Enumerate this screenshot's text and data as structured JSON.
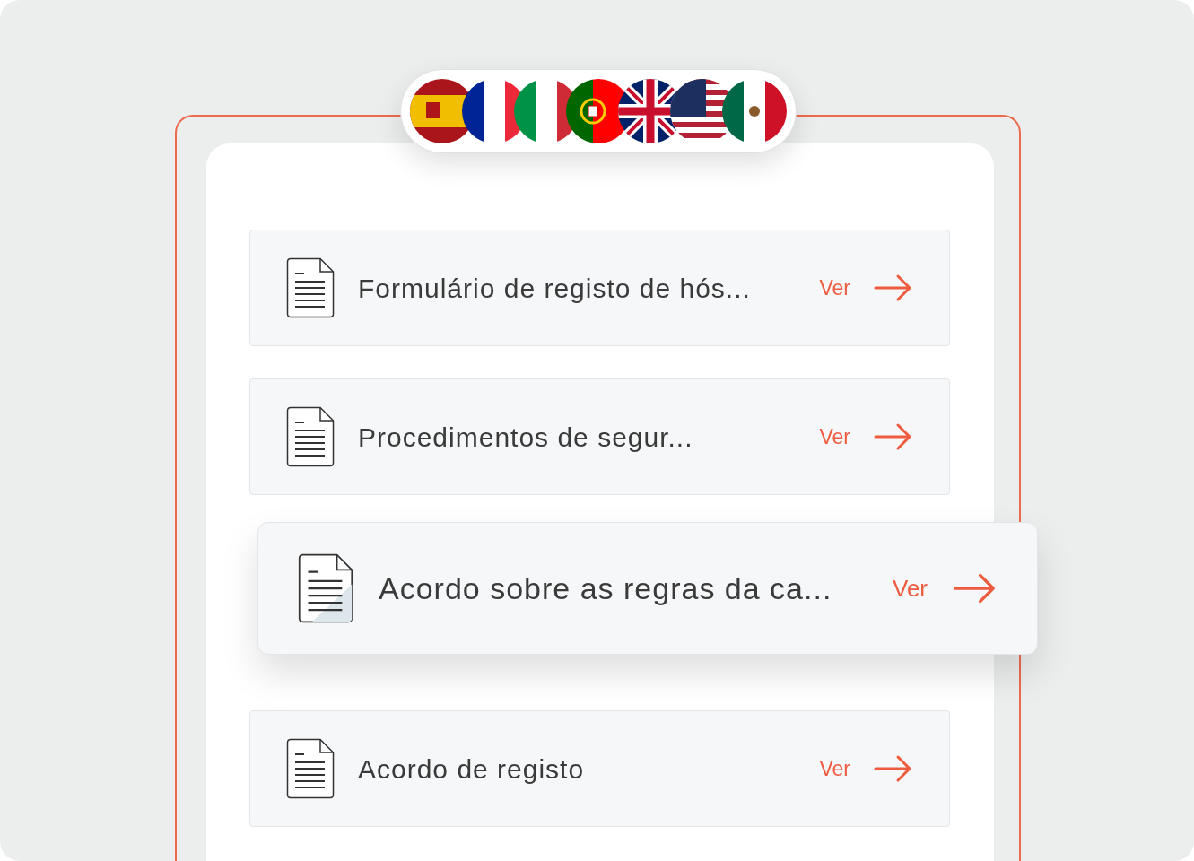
{
  "documents": [
    {
      "title": "Formulário de registo de hós...",
      "action": "Ver",
      "raised": false
    },
    {
      "title": "Procedimentos de segur...",
      "action": "Ver",
      "raised": false
    },
    {
      "title": "Acordo sobre as regras da ca...",
      "action": "Ver",
      "raised": true
    },
    {
      "title": "Acordo de registo",
      "action": "Ver",
      "raised": false
    }
  ]
}
